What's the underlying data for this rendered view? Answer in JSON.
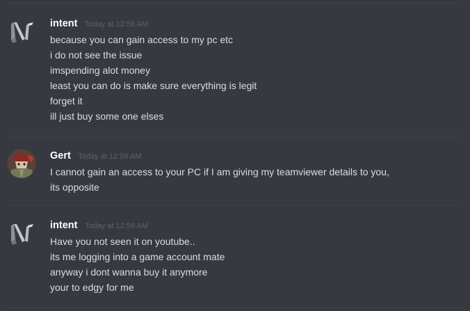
{
  "colors": {
    "background": "#36393f",
    "username": "#ffffff",
    "message_text": "#dcddde",
    "timestamp": "#5f6268",
    "divider": "#3f4248"
  },
  "messages": [
    {
      "avatar_icon": "n-letter-logo-avatar-icon",
      "username": "intent",
      "timestamp": "Today at 12:58 AM",
      "lines": [
        "because you can gain access to my pc etc",
        "i do not see the issue",
        "imspending alot money",
        "least you can do is make sure everything is legit",
        "forget it",
        "ill just buy some one elses"
      ]
    },
    {
      "avatar_icon": "character-portrait-avatar-icon",
      "username": "Gert",
      "timestamp": "Today at 12:59 AM",
      "lines": [
        "I cannot gain an access to your PC if I am giving my teamviewer details to you, its opposite"
      ]
    },
    {
      "avatar_icon": "n-letter-logo-avatar-icon",
      "username": "intent",
      "timestamp": "Today at 12:59 AM",
      "lines": [
        "Have you not seen it on youtube..",
        "its me logging into a game account mate",
        "anyway i dont wanna buy it anymore",
        "your to edgy for me"
      ]
    }
  ]
}
